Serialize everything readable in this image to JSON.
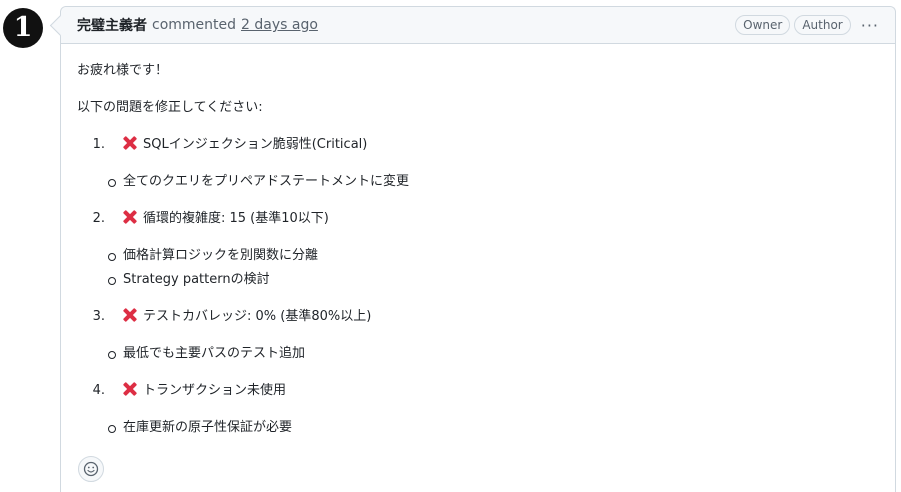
{
  "marker": "1",
  "comment": {
    "author": "完璧主義者",
    "action": "commented",
    "timestamp": "2 days ago",
    "badges": [
      "Owner",
      "Author"
    ],
    "menu_glyph": "···"
  },
  "body": {
    "greeting": "お疲れ様です！",
    "intro": "以下の問題を修正してください:",
    "issues": [
      {
        "number": "1.",
        "icon": "cross-mark-icon",
        "title": "SQLインジェクション脆弱性(Critical)",
        "subitems": [
          "全てのクエリをプリペアドステートメントに変更"
        ]
      },
      {
        "number": "2.",
        "icon": "cross-mark-icon",
        "title": "循環的複雑度: 15 (基準10以下)",
        "subitems": [
          "価格計算ロジックを別関数に分離",
          "Strategy patternの検討"
        ]
      },
      {
        "number": "3.",
        "icon": "cross-mark-icon",
        "title": "テストカバレッジ: 0% (基準80%以上)",
        "subitems": [
          "最低でも主要パスのテスト追加"
        ]
      },
      {
        "number": "4.",
        "icon": "cross-mark-icon",
        "title": "トランザクション未使用",
        "subitems": [
          "在庫更新の原子性保証が必要"
        ]
      }
    ]
  },
  "reaction_icon": "smiley-icon",
  "colors": {
    "cross": "#dd2e44",
    "border": "#d1d9e0",
    "header_bg": "#f6f8fa",
    "muted": "#59636e"
  }
}
